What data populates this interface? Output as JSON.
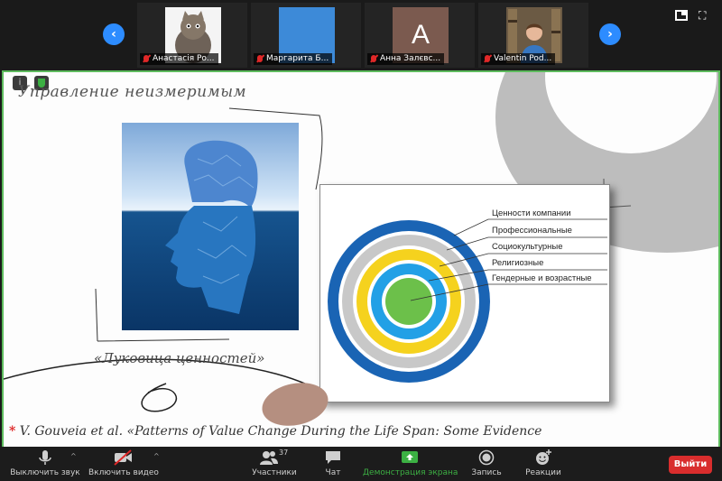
{
  "participants": [
    {
      "name": "Анастасія Ро...",
      "avatar": "cat-photo",
      "muted": true
    },
    {
      "name": "Маргарита Б...",
      "avatar": "blue-tile",
      "color": "#3d8ad8",
      "muted": true
    },
    {
      "name": "Анна Залєвс...",
      "avatar": "letter",
      "letter": "A",
      "color": "#7b5a4f",
      "muted": true
    },
    {
      "name": "Valentin Pod...",
      "avatar": "person-photo",
      "muted": true
    }
  ],
  "slide": {
    "title": "Управление неизмеримым",
    "caption": "«Луковица ценностей»",
    "footnote_star": "*",
    "footnote": "V. Gouveia et al. «Patterns of Value Change During the Life Span: Some Evidence",
    "diagram": {
      "labels": [
        "Ценности компании",
        "Профессиональные",
        "Социокультурные",
        "Религиозные",
        "Гендерные и возрастные"
      ],
      "ring_colors": [
        "#1a64b4",
        "#c8c8c8",
        "#f5d21e",
        "#22a0e6",
        "#6cc04a"
      ]
    }
  },
  "toolbar": {
    "mute": "Выключить звук",
    "video": "Включить видео",
    "participants": "Участники",
    "participant_count": "37",
    "chat": "Чат",
    "share": "Демонстрация экрана",
    "record": "Запись",
    "reactions": "Реакции",
    "leave": "Выйти"
  },
  "colors": {
    "accent": "#2d8cff",
    "share_green": "#3cb043",
    "leave_red": "#d92d2d"
  }
}
